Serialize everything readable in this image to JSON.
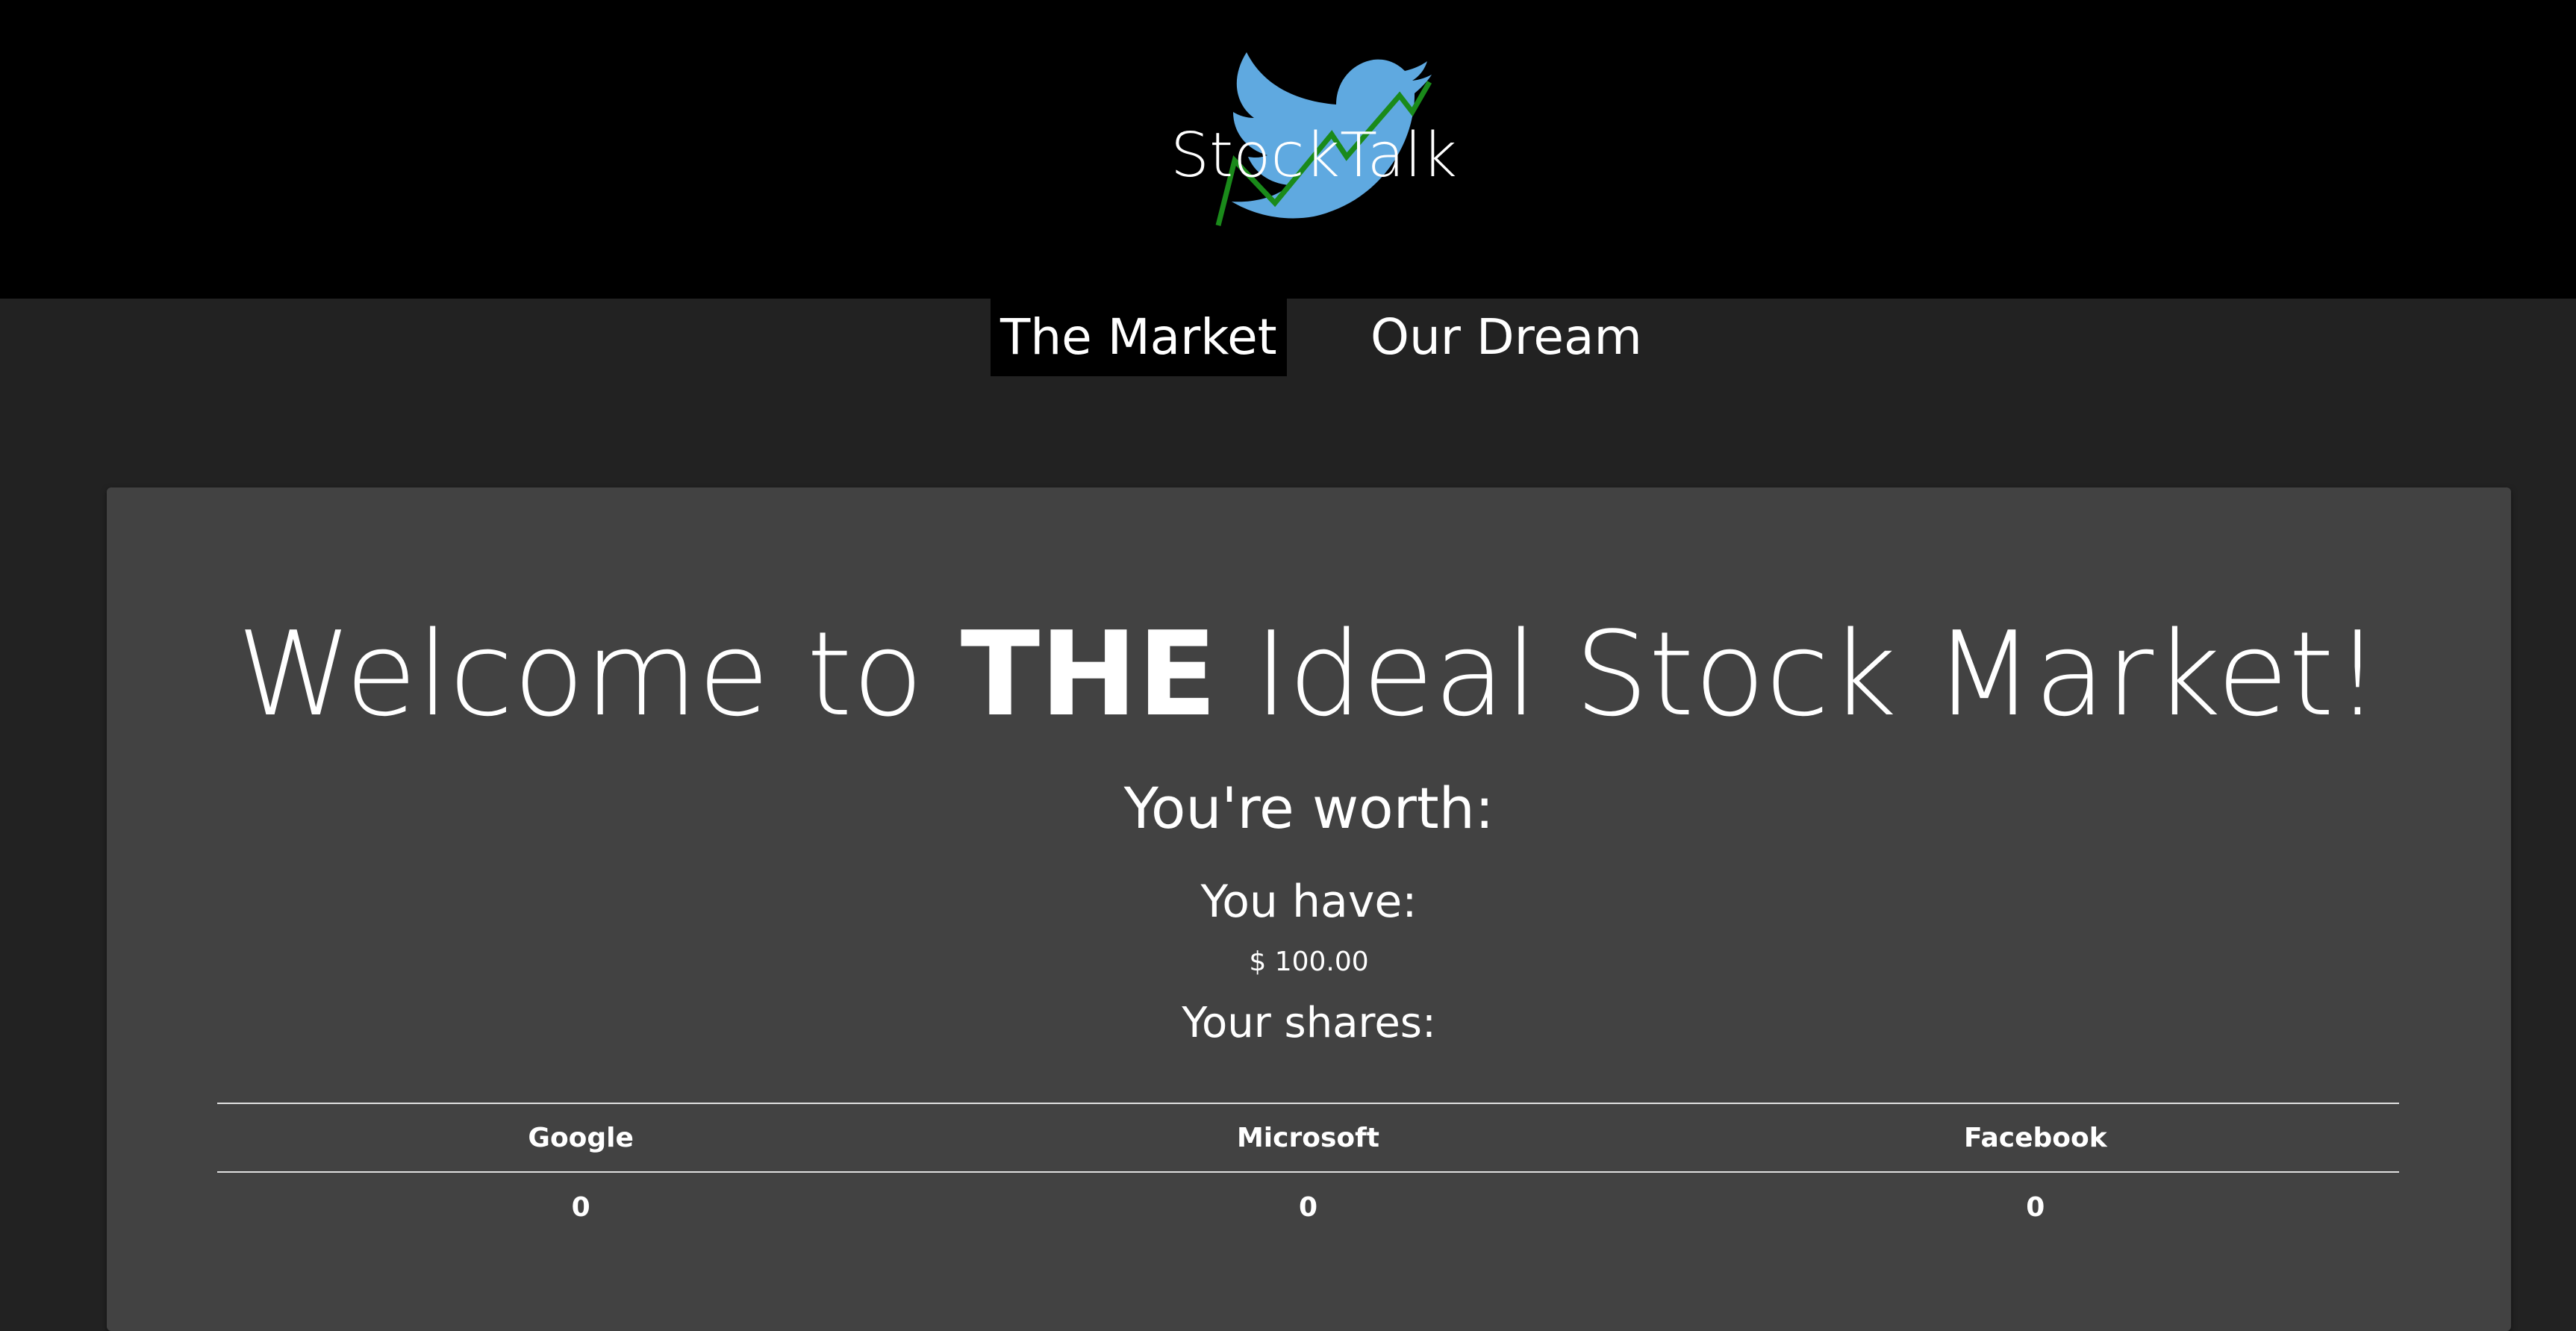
{
  "header": {
    "logo_text": "StockTalk",
    "logo_icon": "bird-with-stock-chart-icon",
    "colors": {
      "bird": "#5fa9e0",
      "chart_line": "#1a8a1a"
    }
  },
  "nav": {
    "items": [
      {
        "label": "The Market",
        "active": true
      },
      {
        "label": "Our Dream",
        "active": false
      }
    ]
  },
  "main": {
    "welcome_prefix": "Welcome to ",
    "welcome_emphasis": "THE",
    "welcome_suffix": " Ideal Stock Market!",
    "worth_label": "You're worth:",
    "have_label": "You have:",
    "cash_value": "$ 100.00",
    "shares_label": "Your shares:",
    "shares_table": {
      "headers": [
        "Google",
        "Microsoft",
        "Facebook"
      ],
      "values": [
        "0",
        "0",
        "0"
      ]
    }
  },
  "colors": {
    "header_bg": "#000000",
    "page_bg": "#222222",
    "card_bg": "#424242",
    "text": "#ffffff"
  }
}
